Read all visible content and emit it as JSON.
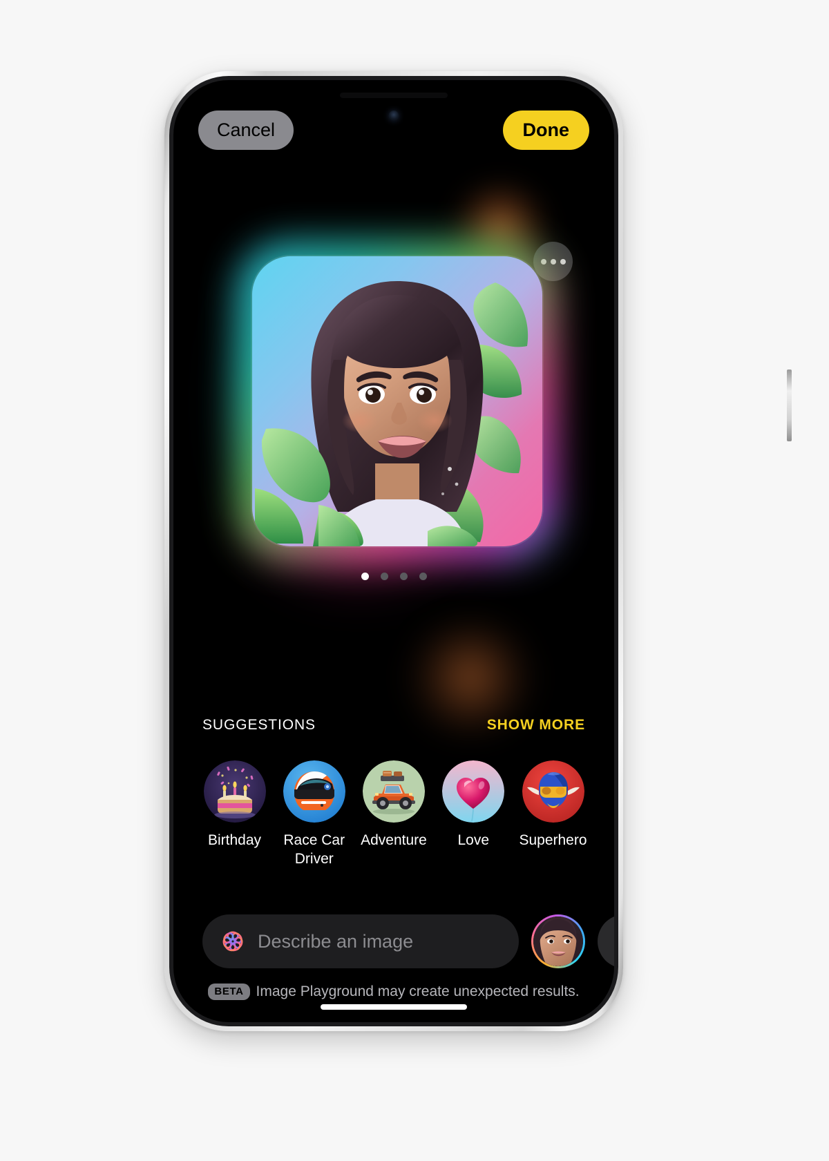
{
  "app": {
    "name": "Image Playground",
    "device": "iPhone"
  },
  "topbar": {
    "cancel_label": "Cancel",
    "done_label": "Done"
  },
  "preview": {
    "more_menu_name": "more-options",
    "pages": 4,
    "active_page": 1,
    "subject_description": "Animated portrait of a smiling young woman with long curly dark hair surrounded by green leaves on a blue-to-pink gradient background"
  },
  "suggestions": {
    "title": "SUGGESTIONS",
    "show_more_label": "SHOW MORE",
    "items": [
      {
        "label": "Birthday",
        "icon": "birthday-cake-icon"
      },
      {
        "label": "Race Car Driver",
        "icon": "racing-helmet-icon"
      },
      {
        "label": "Adventure",
        "icon": "off-road-truck-icon"
      },
      {
        "label": "Love",
        "icon": "heart-balloon-icon"
      },
      {
        "label": "Superhero",
        "icon": "superhero-mask-icon"
      }
    ]
  },
  "composer": {
    "placeholder": "Describe an image",
    "value": "",
    "concept_icon": "playground-knot-icon",
    "avatar_name": "person-avatar",
    "add_label": "+"
  },
  "disclaimer": {
    "badge": "BETA",
    "text": "Image Playground may create unexpected results."
  },
  "colors": {
    "accent_yellow": "#F5D020",
    "cancel_grey": "#8A8A8F",
    "field_bg": "#1E1E20",
    "screen_bg": "#000000"
  }
}
